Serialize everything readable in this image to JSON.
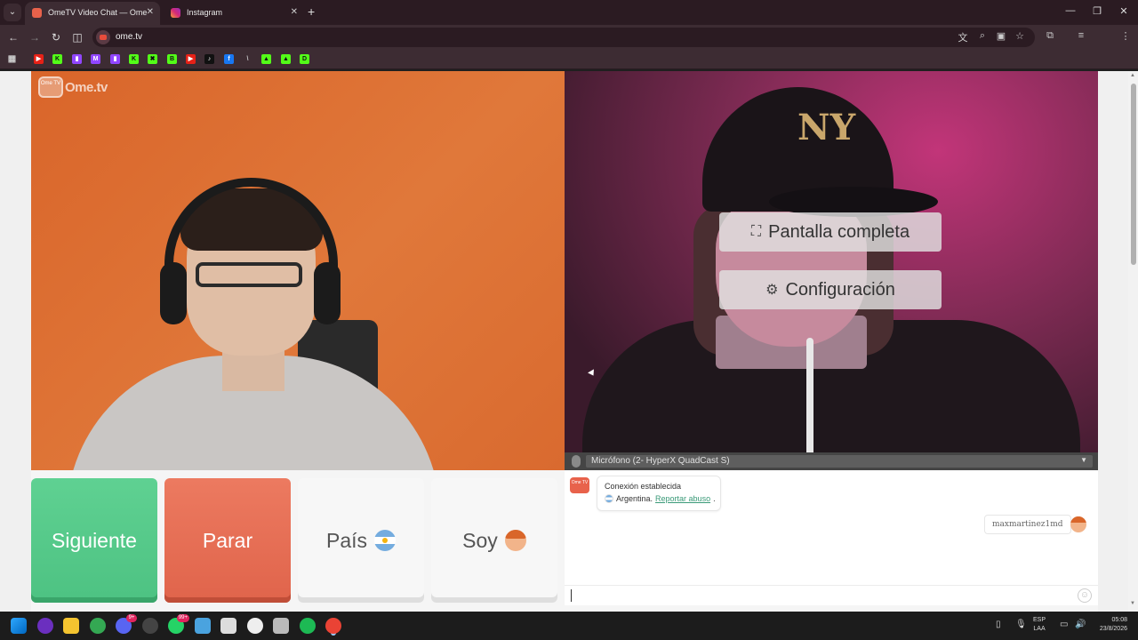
{
  "browser": {
    "tabs": [
      {
        "title": "OmeTV Video Chat — Ome",
        "active": true,
        "icon": "ometv-favicon-icon"
      },
      {
        "title": "Instagram",
        "active": false,
        "icon": "instagram-icon"
      }
    ],
    "url": "ome.tv"
  },
  "site": {
    "logo_text": "Ome.tv",
    "logo_badge": "Ome TV"
  },
  "overlay": {
    "fullscreen_label": "Pantalla completa",
    "settings_label": "Configuración"
  },
  "mic": {
    "selected": "Micrófono (2- HyperX QuadCast S)"
  },
  "controls": {
    "next_label": "Siguiente",
    "stop_label": "Parar",
    "country_label": "País",
    "gender_label": "Soy"
  },
  "chat": {
    "system_line1": "Conexión establecida",
    "system_country": "Argentina.",
    "report_link": "Reportar abuso",
    "report_suffix": ".",
    "username": "maxmartinez1md",
    "input_value": ""
  },
  "taskbar": {
    "badge_discord": "9+",
    "badge_whatsapp": "99+",
    "lang_top": "ESP",
    "lang_bottom": "LAA",
    "time": "05:08",
    "date": "23/8/2026"
  },
  "colors": {
    "next": "#4dc282",
    "stop": "#e0644b",
    "accent_link": "#3a9a78"
  }
}
